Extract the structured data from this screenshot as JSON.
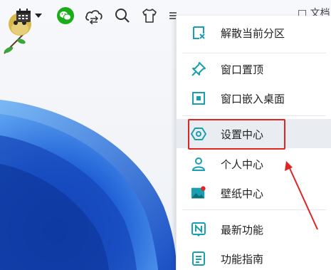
{
  "toolbar": {
    "icons": [
      "calendar-icon",
      "chevron-down-icon",
      "wechat-icon",
      "cloud-sync-icon",
      "search-icon",
      "tshirt-icon",
      "menu-icon"
    ],
    "right_text": "□ 文档"
  },
  "menu": {
    "items": [
      {
        "label": "解散当前分区",
        "icon": "dissolve-partition-icon"
      },
      {
        "label": "窗口置顶",
        "icon": "pin-icon"
      },
      {
        "label": "窗口嵌入桌面",
        "icon": "embed-desktop-icon"
      },
      {
        "label": "设置中心",
        "icon": "settings-icon"
      },
      {
        "label": "个人中心",
        "icon": "user-icon"
      },
      {
        "label": "壁纸中心",
        "icon": "wallpaper-icon"
      },
      {
        "label": "最新功能",
        "icon": "new-feature-icon"
      },
      {
        "label": "功能指南",
        "icon": "guide-icon"
      }
    ]
  },
  "colors": {
    "accent": "#1a9fb0",
    "highlight_bg": "#e9edf2",
    "annotation_red": "#e02424",
    "wechat_green": "#1aad19",
    "wallpaper_blue": "#1f5fd6"
  }
}
